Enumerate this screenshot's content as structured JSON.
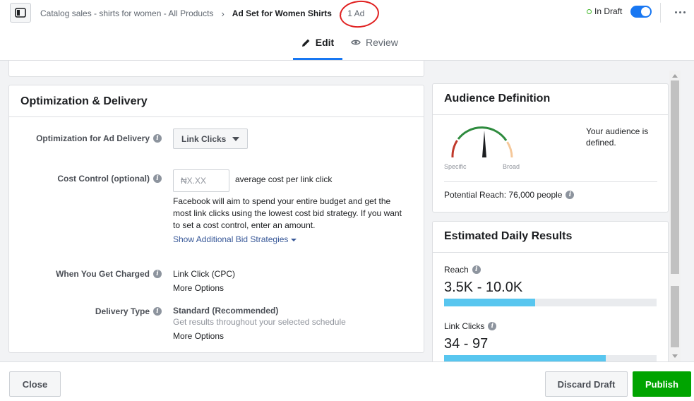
{
  "breadcrumb": {
    "campaign": "Catalog sales - shirts for women - All Products",
    "ad_set": "Ad Set for Women Shirts",
    "ad_count": "1 Ad"
  },
  "status": {
    "label": "In Draft",
    "toggle_on": true
  },
  "tabs": {
    "edit": "Edit",
    "review": "Review"
  },
  "optimization": {
    "title": "Optimization & Delivery",
    "ad_delivery_label": "Optimization for Ad Delivery",
    "ad_delivery_value": "Link Clicks",
    "cost_control_label": "Cost Control (optional)",
    "cost_placeholder": "₦X.XX",
    "cost_suffix": "average cost per link click",
    "cost_help": "Facebook will aim to spend your entire budget and get the most link clicks using the lowest cost bid strategy. If you want to set a cost control, enter an amount.",
    "bid_strategies_link": "Show Additional Bid Strategies",
    "charged_label": "When You Get Charged",
    "charged_value": "Link Click (CPC)",
    "charged_more": "More Options",
    "delivery_type_label": "Delivery Type",
    "delivery_type_value": "Standard (Recommended)",
    "delivery_type_desc": "Get results throughout your selected schedule",
    "delivery_more": "More Options"
  },
  "audience": {
    "title": "Audience Definition",
    "specific_label": "Specific",
    "broad_label": "Broad",
    "status_text": "Your audience is defined.",
    "potential_reach": "Potential Reach: 76,000 people"
  },
  "estimates": {
    "title": "Estimated Daily Results",
    "reach_label": "Reach",
    "reach_value": "3.5K - 10.0K",
    "reach_fill": 0.43,
    "clicks_label": "Link Clicks",
    "clicks_value": "34 - 97",
    "clicks_fill": 0.76
  },
  "footer": {
    "close": "Close",
    "discard": "Discard Draft",
    "publish": "Publish"
  },
  "colors": {
    "accent": "#1877f2",
    "publish": "#00a400",
    "bar": "#58c6ef",
    "link": "#385898"
  }
}
